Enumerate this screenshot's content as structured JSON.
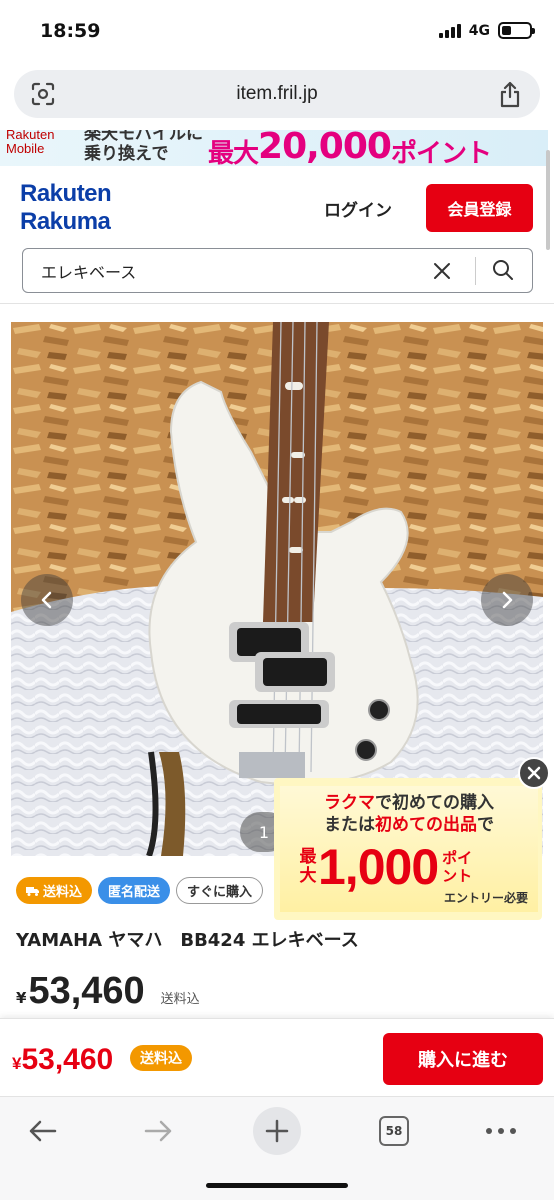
{
  "status_bar": {
    "time": "18:59",
    "network": "4G",
    "battery_level": 0.35
  },
  "browser": {
    "url": "item.fril.jp",
    "tab_count": "58"
  },
  "banner": {
    "brand_top": "Rakuten",
    "brand_bottom": "Mobile",
    "line1": "楽天モバイルに",
    "line2": "乗り換えで",
    "promo_prefix": "最大",
    "promo_amount": "20,000",
    "promo_suffix": "ポイント"
  },
  "header": {
    "logo_line1": "Rakuten",
    "logo_line2": "Rakuma",
    "login_label": "ログイン",
    "register_label": "会員登録"
  },
  "search": {
    "value": "エレキベース"
  },
  "gallery": {
    "counter": "1"
  },
  "tags": [
    "送料込",
    "匿名配送",
    "すぐに購入"
  ],
  "product": {
    "title": "YAMAHA ヤマハ　BB424 エレキベース",
    "currency": "¥",
    "price": "53,460",
    "shipping": "送料込"
  },
  "promo_popup": {
    "line1_a": "ラクマ",
    "line1_b": "で初めての購入",
    "line2_a": "または",
    "line2_b": "初めての出品",
    "line2_c": "で",
    "prefix_1": "最",
    "prefix_2": "大",
    "amount": "1,000",
    "unit_1": "ポイ",
    "unit_2": "ント",
    "note": "エントリー必要"
  },
  "buy_bar": {
    "currency": "¥",
    "price": "53,460",
    "shipping_badge": "送料込",
    "buy_label": "購入に進む"
  },
  "colors": {
    "brand_red": "#e60012",
    "rakuma_blue": "#0b3ea8",
    "badge_orange": "#f39800",
    "badge_blue": "#3a8fe8",
    "promo_magenta": "#e4007f"
  }
}
